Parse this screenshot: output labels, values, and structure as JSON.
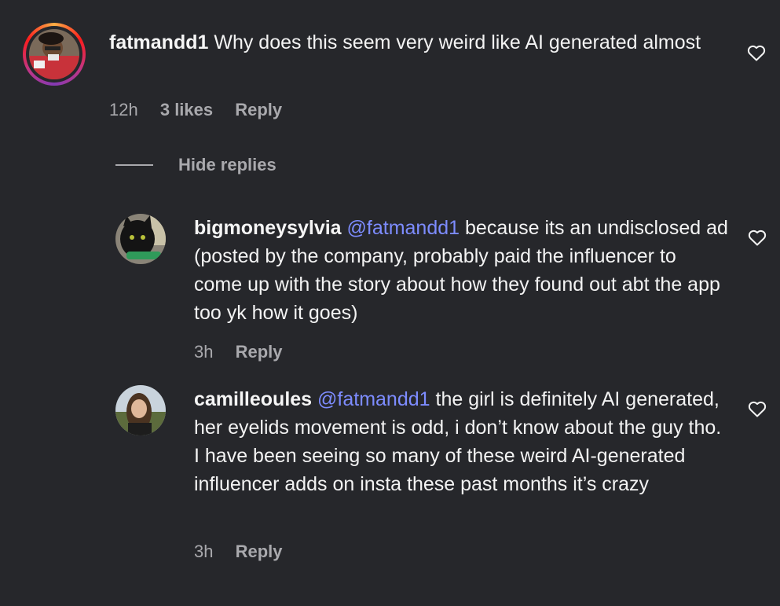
{
  "comments": [
    {
      "username": "fatmandd1",
      "text": "Why does this seem very weird like AI generated almost",
      "time": "12h",
      "likes": "3 likes",
      "reply_label": "Reply"
    }
  ],
  "hide_replies_label": "Hide replies",
  "replies": [
    {
      "username": "bigmoneysylvia",
      "mention": "@fatmandd1",
      "text": "because its an undisclosed ad (posted by the company, probably paid the influencer to come up with the story about how they found out abt the app too yk how it goes)",
      "time": "3h",
      "reply_label": "Reply"
    },
    {
      "username": "camilleoules",
      "mention": "@fatmandd1",
      "text": "the girl is definitely AI generated, her eyelids movement is odd, i don’t know about the guy tho. I have been seeing so many of these weird AI-generated influencer adds on insta these past months it’s crazy",
      "time": "3h",
      "reply_label": "Reply"
    }
  ],
  "icons": {
    "like": "heart-icon"
  },
  "colors": {
    "background": "#26272b",
    "mention": "#7d8cff",
    "meta": "#a9a9ad"
  }
}
